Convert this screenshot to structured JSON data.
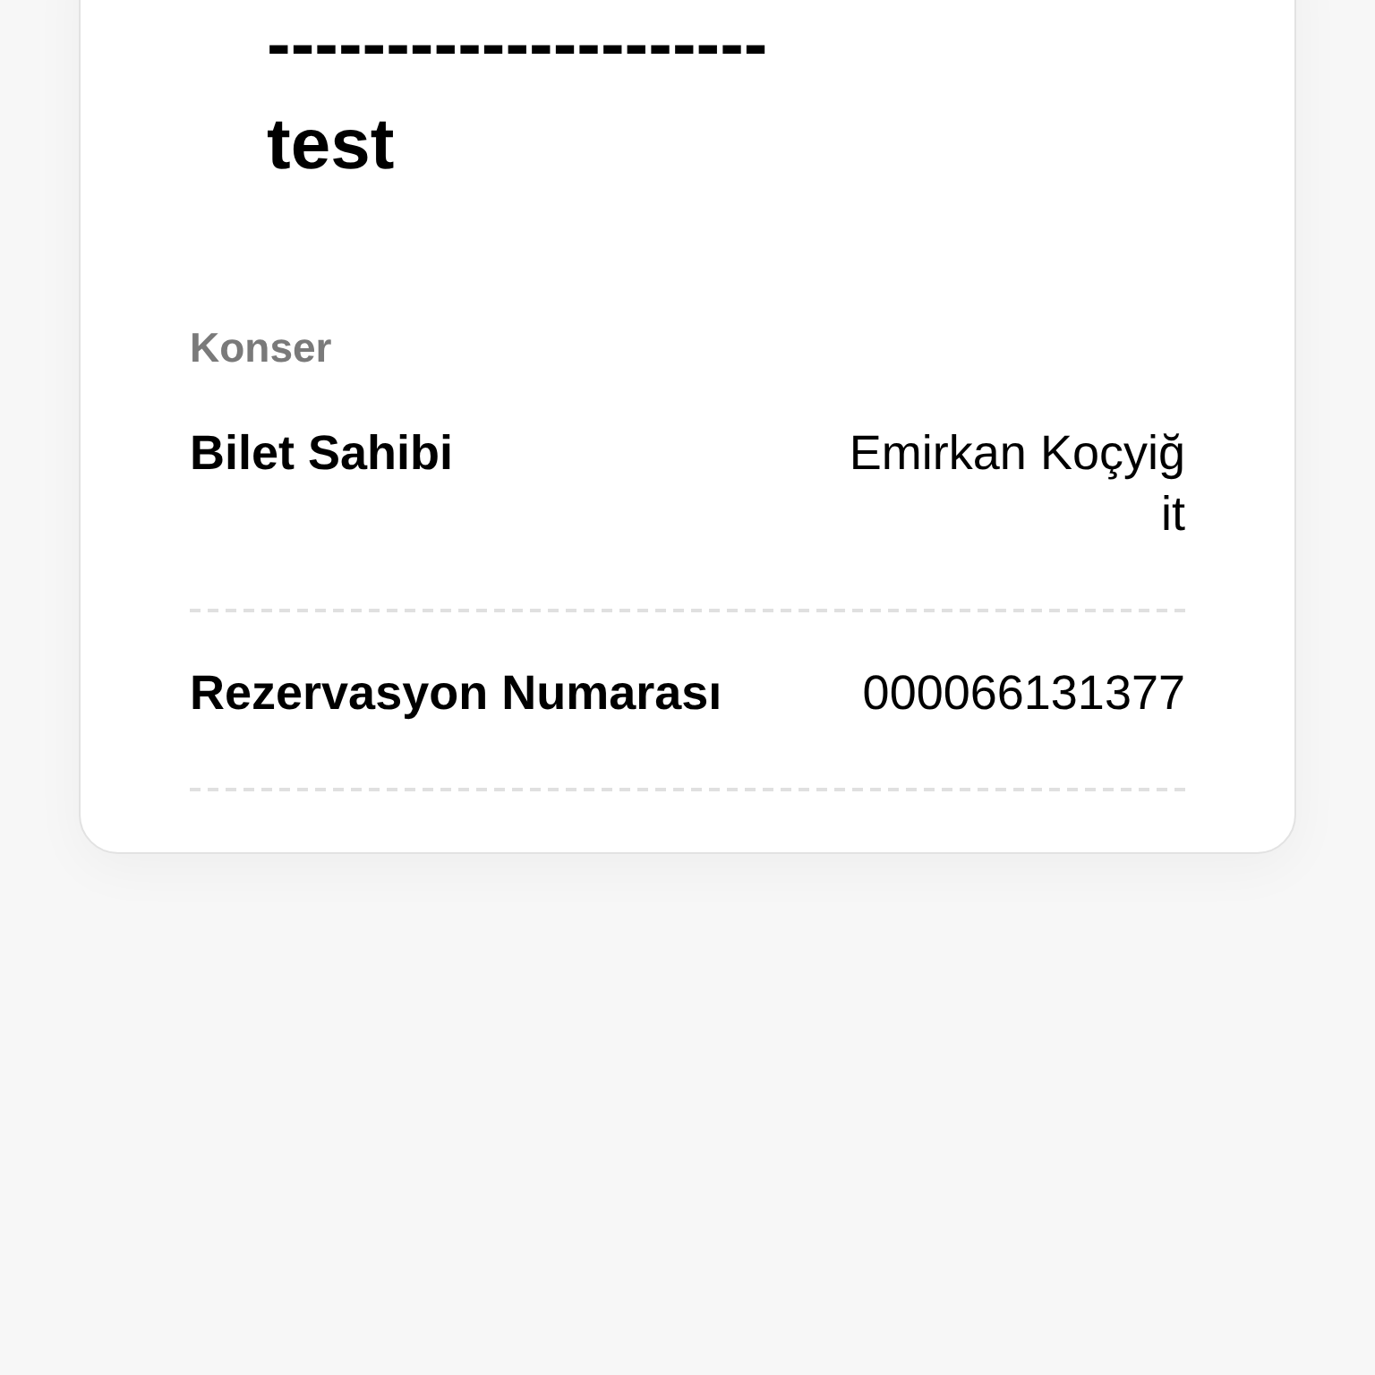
{
  "ticket": {
    "title_lines": [
      "---------------------",
      "test"
    ],
    "category": "Konser",
    "fields": [
      {
        "label": "Bilet Sahibi",
        "value": "Emirkan Koçyiğit"
      },
      {
        "label": "Rezervasyon Numarası",
        "value": "000066131377"
      }
    ]
  }
}
